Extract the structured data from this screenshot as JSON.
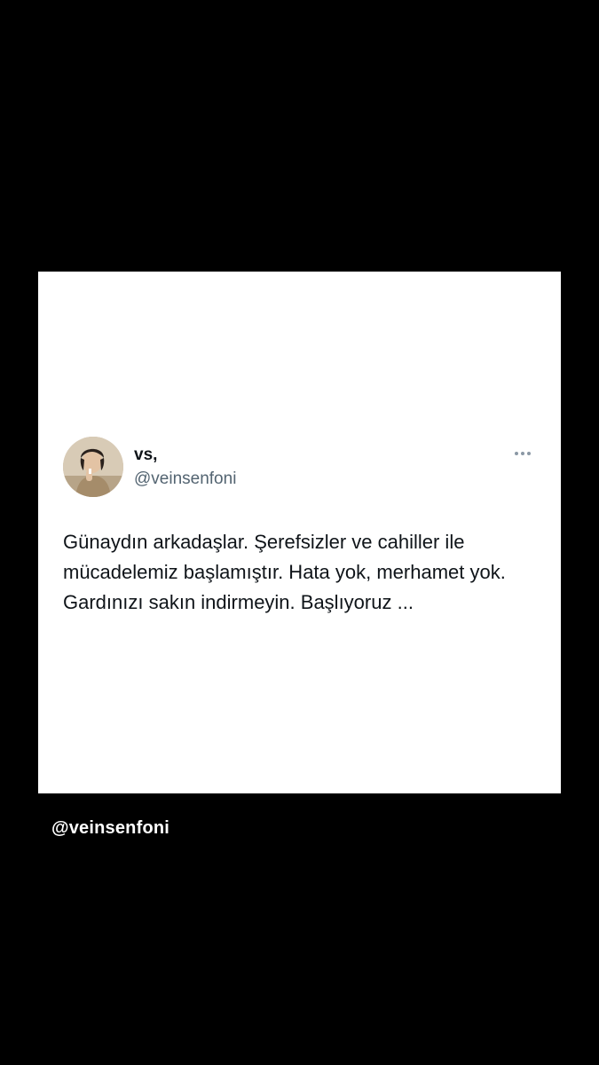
{
  "tweet": {
    "display_name": "vs,",
    "handle": "@veinsenfoni",
    "text": "Günaydın arkadaşlar. Şerefsizler ve cahiller ile mücadelemiz başlamıştır. Hata yok, merhamet yok. Gardınızı sakın indirmeyin. Başlıyoruz ...",
    "avatar_icon": "profile-photo",
    "more_icon": "more-dots-icon"
  },
  "watermark": {
    "text": "@veinsenfoni"
  },
  "colors": {
    "background": "#000000",
    "card": "#ffffff",
    "primary_text": "#0f1419",
    "secondary_text": "#536471",
    "watermark_text": "#ffffff"
  }
}
